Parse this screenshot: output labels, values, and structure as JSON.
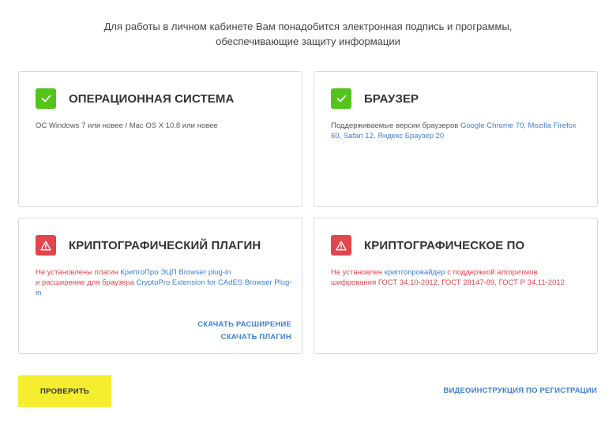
{
  "intro": {
    "line1": "Для работы в личном кабинете Вам понадобится электронная подпись и программы,",
    "line2": "обеспечивающие защиту информации"
  },
  "colors": {
    "ok": "#52c41a",
    "error": "#e4444b",
    "link": "#3d7fd0",
    "button": "#f5ee2f"
  },
  "cards": {
    "os": {
      "status": "ok",
      "icon": "check-icon",
      "title": "ОПЕРАЦИОННАЯ СИСТЕМА",
      "description": "ОС Windows 7 или новее / Mac OS X 10.8 или новее"
    },
    "browser": {
      "status": "ok",
      "icon": "check-icon",
      "title": "БРАУЗЕР",
      "desc_prefix": "Поддерживаемые версии браузеров ",
      "desc_link": "Google Chrome 70, Mozilla Firefox 60, Safari 12, Яндекс Браузер 20"
    },
    "plugin": {
      "status": "error",
      "icon": "warning-icon",
      "title": "КРИПТОГРАФИЧЕСКИЙ ПЛАГИН",
      "desc_part1": "Не установлены плагин ",
      "desc_link1": "КриптоПро ЭЦП Browser plug-in",
      "desc_part2": "и расширение для браузера ",
      "desc_link2": "CryptoPro Extension for CAdES Browser Plug-in",
      "download_extension": "СКАЧАТЬ РАСШИРЕНИЕ",
      "download_plugin": "СКАЧАТЬ ПЛАГИН"
    },
    "crypto": {
      "status": "error",
      "icon": "warning-icon",
      "title": "КРИПТОГРАФИЧЕСКОЕ ПО",
      "desc_part1": "Не установлен ",
      "desc_link1": "криптопровайдер",
      "desc_part2": " с поддержкой алгоритмов шифрования ГОСТ 34.10-2012, ГОСТ 28147-89, ГОСТ Р 34.11-2012"
    }
  },
  "footer": {
    "check_button": "ПРОВЕРИТЬ",
    "video_link": "ВИДЕОИНСТРУКЦИЯ ПО РЕГИСТРАЦИИ"
  }
}
